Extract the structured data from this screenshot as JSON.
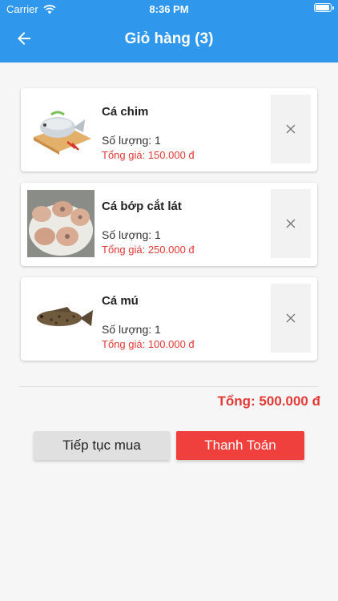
{
  "status_bar": {
    "carrier": "Carrier",
    "time": "8:36 PM",
    "battery_level": 0.95
  },
  "header": {
    "title": "Giỏ hàng (3)"
  },
  "cart": {
    "items": [
      {
        "name": "Cá chim",
        "quantity": "Số lượng: 1",
        "total": "Tổng giá: 150.000 đ",
        "image_icon": "pomfret-fish-icon"
      },
      {
        "name": "Cá bớp cắt lát",
        "quantity": "Số lượng: 1",
        "total": "Tổng giá: 250.000 đ",
        "image_icon": "sliced-cobia-icon"
      },
      {
        "name": "Cá mú",
        "quantity": "Số lượng: 1",
        "total": "Tổng giá: 100.000 đ",
        "image_icon": "grouper-fish-icon"
      }
    ],
    "grand_total": "Tổng: 500.000 đ"
  },
  "actions": {
    "continue_label": "Tiếp tục mua",
    "checkout_label": "Thanh Toán"
  },
  "colors": {
    "primary": "#2f97ec",
    "accent_red": "#e53935",
    "checkout_button": "#f0403d"
  }
}
